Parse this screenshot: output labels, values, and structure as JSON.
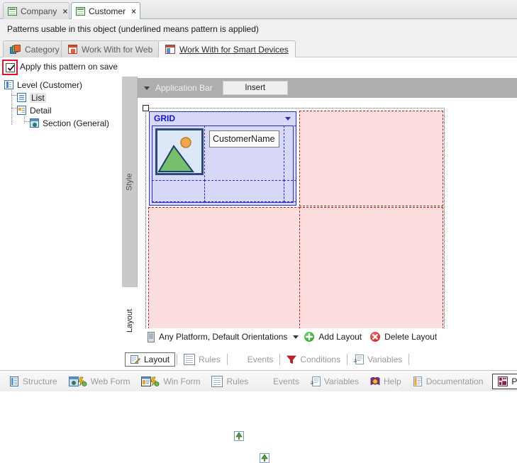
{
  "document_tabs": [
    {
      "label": "Company",
      "icon": "grid-document-icon",
      "active": false,
      "close": "×"
    },
    {
      "label": "Customer",
      "icon": "grid-document-icon",
      "active": true,
      "close": "×"
    }
  ],
  "patterns_header": {
    "text": "Patterns usable in this object (underlined means pattern is applied)"
  },
  "pattern_tabs": [
    {
      "label": "Category",
      "icon": "category-icon",
      "active": false,
      "applied": false
    },
    {
      "label": "Work With for Web",
      "icon": "web-pattern-icon",
      "active": false,
      "applied": false
    },
    {
      "label": "Work With for Smart Devices",
      "icon": "smart-device-pattern-icon",
      "active": true,
      "applied": true
    }
  ],
  "apply_on_save": {
    "label": "Apply this pattern on save",
    "checked": true,
    "highlight_color": "#e8112d"
  },
  "tree": {
    "nodes": [
      {
        "label": "Level (Customer)",
        "icon": "level-icon",
        "depth": 0,
        "selected": false
      },
      {
        "label": "List",
        "icon": "list-icon",
        "depth": 1,
        "selected": true
      },
      {
        "label": "Detail",
        "icon": "detail-icon",
        "depth": 1,
        "selected": false
      },
      {
        "label": "Section (General)",
        "icon": "section-icon",
        "depth": 2,
        "selected": false
      }
    ]
  },
  "side_tabs": [
    {
      "label": "Style",
      "active": false
    },
    {
      "label": "Layout",
      "active": true
    }
  ],
  "designer": {
    "app_bar": {
      "label": "Application Bar",
      "caret": "collapse-caret-icon"
    },
    "insert_button": "Insert",
    "grid_control": {
      "title": "GRID",
      "caret": "dropdown-caret-icon",
      "image_placeholder": "image-placeholder-icon",
      "text_field": "CustomerName"
    }
  },
  "layout_toolbar": {
    "platform_label": "Any Platform, Default Orientations",
    "platform_icon": "mobile-device-icon",
    "dropdown_caret": "dropdown-caret-icon",
    "add_layout": {
      "label": "Add Layout",
      "icon": "add-circle-icon"
    },
    "delete_layout": {
      "label": "Delete Layout",
      "icon": "delete-circle-icon"
    }
  },
  "inner_tabs": [
    {
      "label": "Layout",
      "icon": "pencil-layout-icon",
      "active": true
    },
    {
      "label": "Rules",
      "icon": "rules-page-icon",
      "active": false
    },
    {
      "label": "Events",
      "icon": "events-tree-icon",
      "active": false
    },
    {
      "label": "Conditions",
      "icon": "conditions-funnel-icon",
      "active": false
    },
    {
      "label": "Variables",
      "icon": "variables-icon",
      "active": false
    }
  ],
  "bottom_tabs": [
    {
      "label": "Structure",
      "icon": "structure-icon",
      "active": false
    },
    {
      "label": "Web Form",
      "icon": "web-form-icon",
      "active": false
    },
    {
      "label": "Win Form",
      "icon": "win-form-icon",
      "active": false
    },
    {
      "label": "Rules",
      "icon": "rules-page-icon",
      "active": false
    },
    {
      "label": "Events",
      "icon": "events-tree-icon",
      "active": false
    },
    {
      "label": "Variables",
      "icon": "variables-icon",
      "active": false
    },
    {
      "label": "Help",
      "icon": "help-book-icon",
      "active": false
    },
    {
      "label": "Documentation",
      "icon": "documentation-icon",
      "active": false
    },
    {
      "label": "Patterns",
      "icon": "patterns-icon",
      "active": true
    }
  ],
  "colors": {
    "grid_accent": "#1414d2",
    "cell_pink": "#fcdede",
    "cell_border": "#b02121",
    "highlight_red": "#e8112d"
  }
}
